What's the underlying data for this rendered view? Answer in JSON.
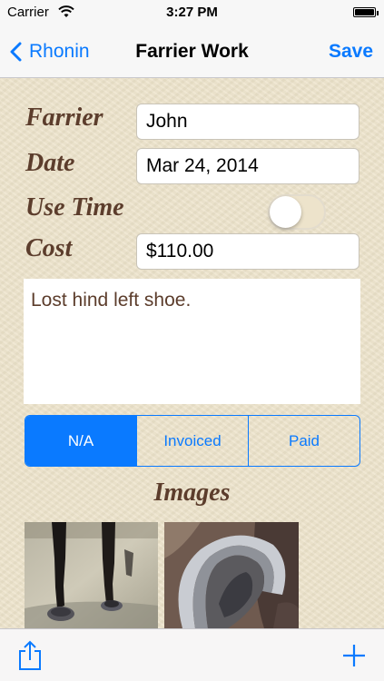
{
  "status_bar": {
    "carrier": "Carrier",
    "time": "3:27 PM"
  },
  "nav": {
    "back_label": "Rhonin",
    "title": "Farrier Work",
    "save_label": "Save"
  },
  "form": {
    "farrier_label": "Farrier",
    "farrier_value": "John",
    "date_label": "Date",
    "date_value": "Mar 24, 2014",
    "use_time_label": "Use Time",
    "use_time_on": false,
    "cost_label": "Cost",
    "cost_value": "$110.00",
    "notes": "Lost hind left shoe."
  },
  "payment_status": {
    "options": [
      "N/A",
      "Invoiced",
      "Paid"
    ],
    "selected": "N/A"
  },
  "images": {
    "heading": "Images",
    "count_visible": 2
  },
  "toolbar": {
    "left_icon": "share-icon",
    "right_icon": "plus-icon"
  },
  "colors": {
    "accent": "#0a7aff",
    "label_brown": "#5c3d2c",
    "background": "#ede3cb"
  }
}
